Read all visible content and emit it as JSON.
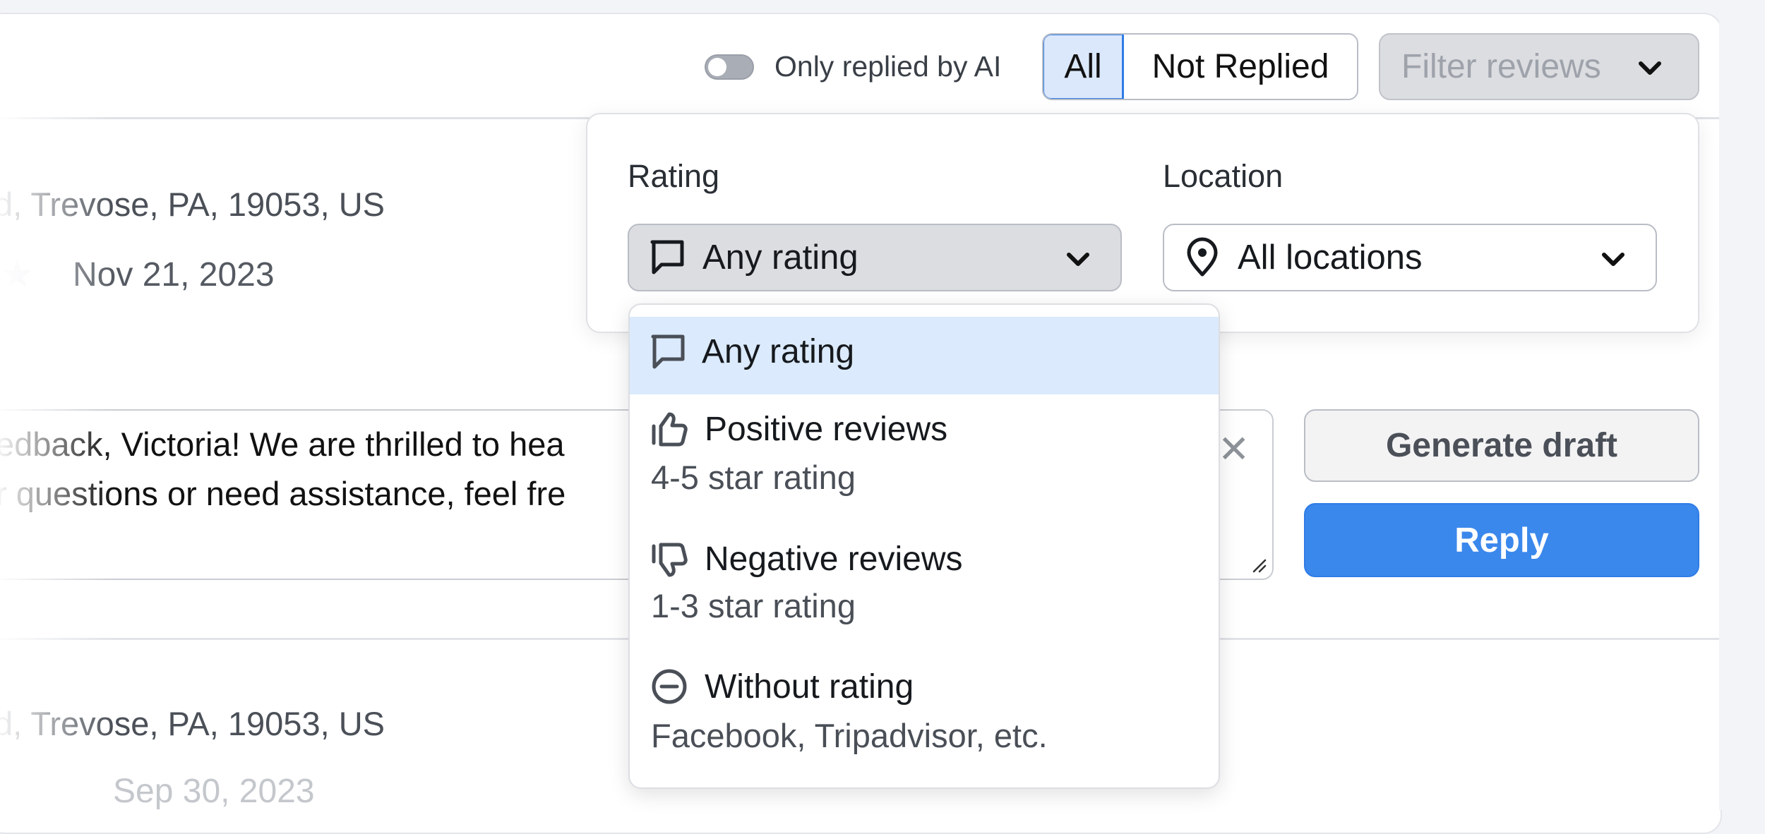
{
  "header": {
    "toggle_label": "Only replied by AI",
    "toggle_on": false,
    "segments": [
      {
        "label": "All",
        "selected": true
      },
      {
        "label": "Not Replied",
        "selected": false
      }
    ],
    "filter_button_label": "Filter reviews"
  },
  "filter_panel": {
    "rating_label": "Rating",
    "rating_selected": "Any rating",
    "location_label": "Location",
    "location_selected": "All locations"
  },
  "rating_menu": {
    "items": [
      {
        "icon": "speech-bubble-icon",
        "title": "Any rating",
        "subtitle": "",
        "highlighted": true
      },
      {
        "icon": "thumbs-up-icon",
        "title": "Positive reviews",
        "subtitle": "4-5 star rating",
        "highlighted": false
      },
      {
        "icon": "thumbs-down-icon",
        "title": "Negative reviews",
        "subtitle": "1-3 star rating",
        "highlighted": false
      },
      {
        "icon": "minus-circle-icon",
        "title": "Without rating",
        "subtitle": "Facebook, Tripadvisor, etc.",
        "highlighted": false
      }
    ]
  },
  "reviews": [
    {
      "address": "d, Trevose, PA, 19053, US",
      "date": "Nov 21, 2023",
      "reply_line_1": "edback, Victoria! We are thrilled to hea",
      "reply_line_2": "r questions or need assistance, feel fre"
    },
    {
      "address": "d, Trevose, PA, 19053, US",
      "date": "Sep 30, 2023"
    }
  ],
  "actions": {
    "generate_draft": "Generate draft",
    "reply": "Reply"
  },
  "colors": {
    "accent": "#3b88ec",
    "selected_bg": "#dbeafc",
    "select_bg": "#dcdde1"
  }
}
